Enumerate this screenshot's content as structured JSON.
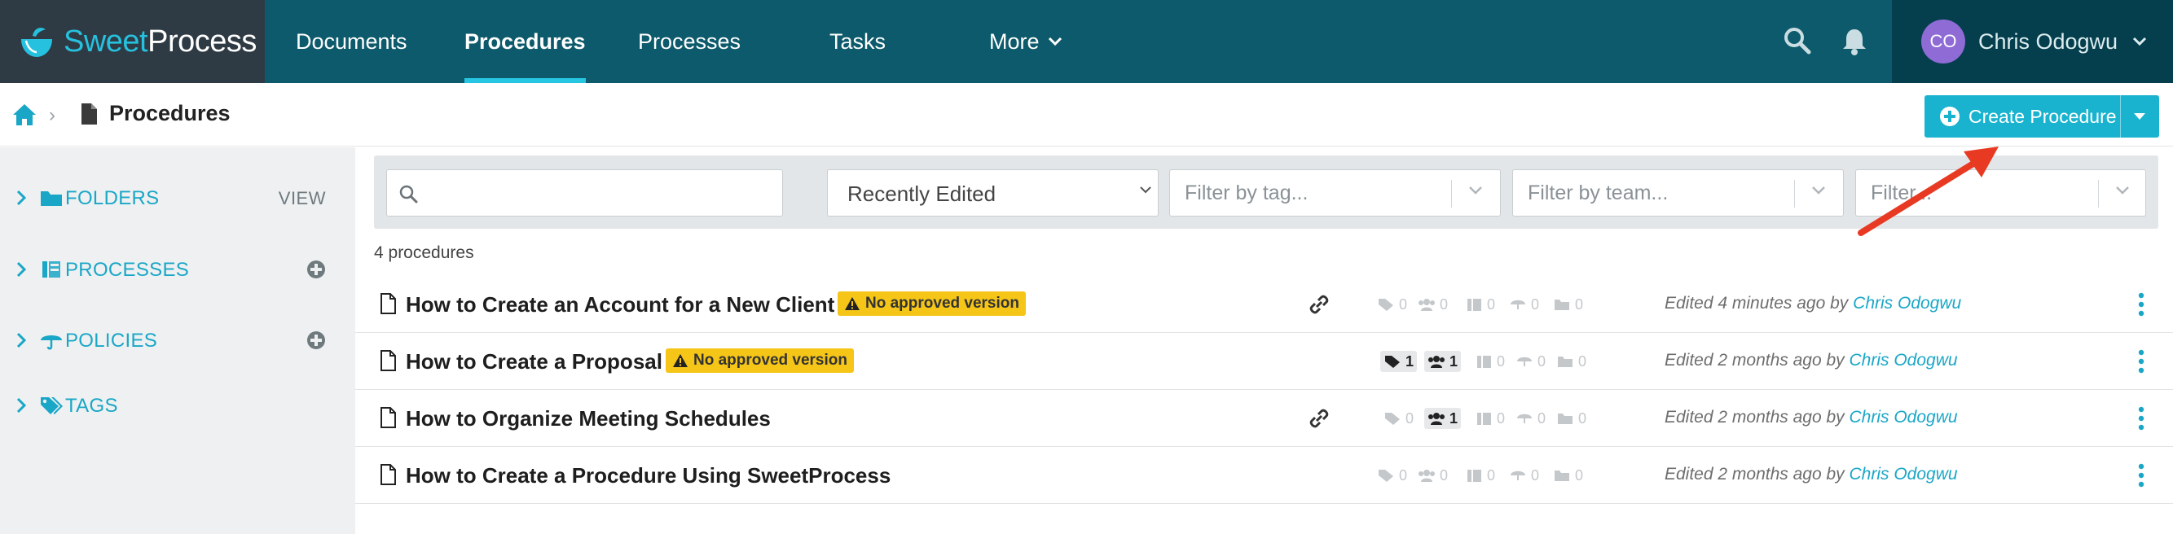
{
  "app": {
    "logo_text_a": "Sweet",
    "logo_text_b": "Process",
    "brand_color": "#26c1de",
    "nav_bg": "#0c5a6b"
  },
  "nav": {
    "items": [
      {
        "label": "Documents",
        "active": false
      },
      {
        "label": "Procedures",
        "active": true
      },
      {
        "label": "Processes",
        "active": false
      },
      {
        "label": "Tasks",
        "active": false
      },
      {
        "label": "More",
        "active": false
      }
    ],
    "search_icon": "search-icon",
    "bell_icon": "bell-icon"
  },
  "user": {
    "initials": "CO",
    "name": "Chris Odogwu",
    "avatar_color": "#8f6bd6"
  },
  "breadcrumb": {
    "home_icon": "home-icon",
    "title": "Procedures"
  },
  "create_button": {
    "label": "Create Procedure"
  },
  "sidebar": {
    "items": [
      {
        "label": "FOLDERS",
        "action": "VIEW",
        "icon": "folder-icon"
      },
      {
        "label": "PROCESSES",
        "action": "",
        "icon": "processes-icon"
      },
      {
        "label": "POLICIES",
        "action": "",
        "icon": "umbrella-icon"
      },
      {
        "label": "TAGS",
        "action": "",
        "icon": "tags-icon"
      }
    ]
  },
  "filters": {
    "search_placeholder": "",
    "sort_value": "Recently Edited",
    "tag_placeholder": "Filter by tag...",
    "team_placeholder": "Filter by team...",
    "other_placeholder": "Filter..."
  },
  "results": {
    "count_text": "4 procedures",
    "rows": [
      {
        "title": "How to Create an Account for a New Client",
        "badge": "No approved version",
        "has_link": true,
        "stats": {
          "tags": 0,
          "teams": 0,
          "processes": 0,
          "policies": 0,
          "folders": 0
        },
        "edited": "Edited 4 minutes ago by",
        "editor": "Chris Odogwu"
      },
      {
        "title": "How to Create a Proposal",
        "badge": "No approved version",
        "has_link": false,
        "stats": {
          "tags": 1,
          "teams": 1,
          "processes": 0,
          "policies": 0,
          "folders": 0
        },
        "edited": "Edited 2 months ago by",
        "editor": "Chris Odogwu"
      },
      {
        "title": "How to Organize Meeting Schedules",
        "badge": "",
        "has_link": true,
        "stats": {
          "tags": 0,
          "teams": 1,
          "processes": 0,
          "policies": 0,
          "folders": 0
        },
        "edited": "Edited 2 months ago by",
        "editor": "Chris Odogwu"
      },
      {
        "title": "How to Create a Procedure Using SweetProcess",
        "badge": "",
        "has_link": false,
        "stats": {
          "tags": 0,
          "teams": 0,
          "processes": 0,
          "policies": 0,
          "folders": 0
        },
        "edited": "Edited 2 months ago by",
        "editor": "Chris Odogwu"
      }
    ]
  },
  "badge_color": "#f5c518",
  "accent_color": "#1ab3cf"
}
